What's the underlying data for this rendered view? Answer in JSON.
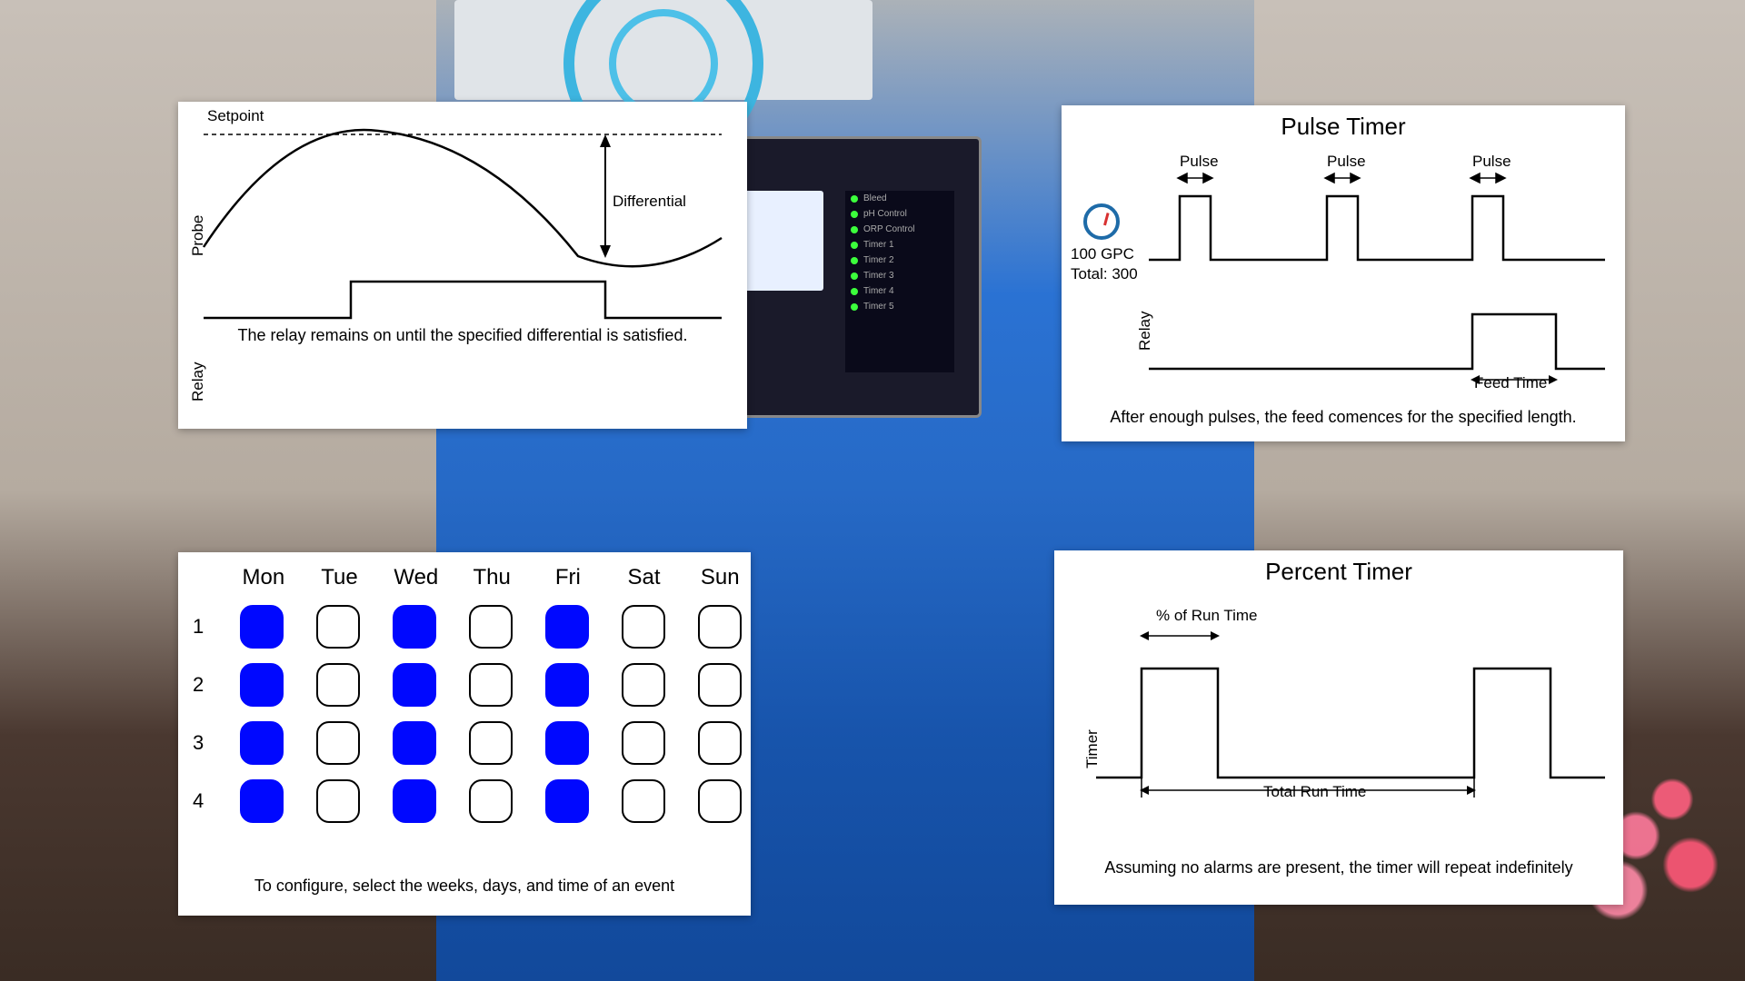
{
  "setpoint": {
    "ylabel_probe": "Probe",
    "ylabel_relay": "Relay",
    "setpoint_label": "Setpoint",
    "differential_label": "Differential",
    "caption": "The relay remains on until the specified differential is satisfied."
  },
  "pulse": {
    "title": "Pulse Timer",
    "pulse_label_1": "Pulse",
    "pulse_label_2": "Pulse",
    "pulse_label_3": "Pulse",
    "gpc_label": "100 GPC",
    "total_label": "Total: 300",
    "ylabel_relay": "Relay",
    "feed_time_label": "Feed Time",
    "caption": "After enough pulses, the feed comences for the specified length."
  },
  "percent": {
    "title": "Percent Timer",
    "ylabel_timer": "Timer",
    "pct_label": "% of Run Time",
    "total_label": "Total Run Time",
    "caption": "Assuming no alarms are present, the timer will repeat indefinitely"
  },
  "schedule": {
    "days": [
      "Mon",
      "Tue",
      "Wed",
      "Thu",
      "Fri",
      "Sat",
      "Sun"
    ],
    "weeks": [
      "1",
      "2",
      "3",
      "4"
    ],
    "grid": [
      [
        true,
        false,
        true,
        false,
        true,
        false,
        false
      ],
      [
        true,
        false,
        true,
        false,
        true,
        false,
        false
      ],
      [
        true,
        false,
        true,
        false,
        true,
        false,
        false
      ],
      [
        true,
        false,
        true,
        false,
        true,
        false,
        false
      ]
    ],
    "caption": "To configure, select the weeks, days, and time of an event"
  },
  "device_leds": [
    "Bleed",
    "pH Control",
    "ORP Control",
    "Timer 1",
    "Timer 2",
    "Timer 3",
    "Timer 4",
    "Timer 5"
  ],
  "chart_data": [
    {
      "type": "line",
      "title": "Setpoint / Differential behavior",
      "series": [
        {
          "name": "Probe",
          "description": "sinusoidal curve approaching setpoint then falling by differential amount"
        },
        {
          "name": "Relay",
          "description": "step: 0 → 1 while probe above (setpoint - differential), then 0"
        }
      ],
      "annotations": [
        "Setpoint (dashed horizontal reference)",
        "Differential (vertical double arrow between setpoint and trough)"
      ]
    },
    {
      "type": "line",
      "title": "Pulse Timer",
      "series": [
        {
          "name": "Pulse input",
          "description": "three narrow pulses at t1,t2,t3"
        },
        {
          "name": "Relay",
          "description": "low until accumulated pulses reach threshold (300 at 100 GPC), then high for Feed Time, then low"
        }
      ]
    },
    {
      "type": "line",
      "title": "Percent Timer",
      "series": [
        {
          "name": "Timer output",
          "description": "periodic square: high for (% of Run Time), low for remainder of Total Run Time, repeating"
        }
      ]
    },
    {
      "type": "table",
      "title": "Weekly schedule matrix",
      "columns": [
        "Mon",
        "Tue",
        "Wed",
        "Thu",
        "Fri",
        "Sat",
        "Sun"
      ],
      "rows": [
        "1",
        "2",
        "3",
        "4"
      ],
      "values": [
        [
          1,
          0,
          1,
          0,
          1,
          0,
          0
        ],
        [
          1,
          0,
          1,
          0,
          1,
          0,
          0
        ],
        [
          1,
          0,
          1,
          0,
          1,
          0,
          0
        ],
        [
          1,
          0,
          1,
          0,
          1,
          0,
          0
        ]
      ]
    }
  ]
}
